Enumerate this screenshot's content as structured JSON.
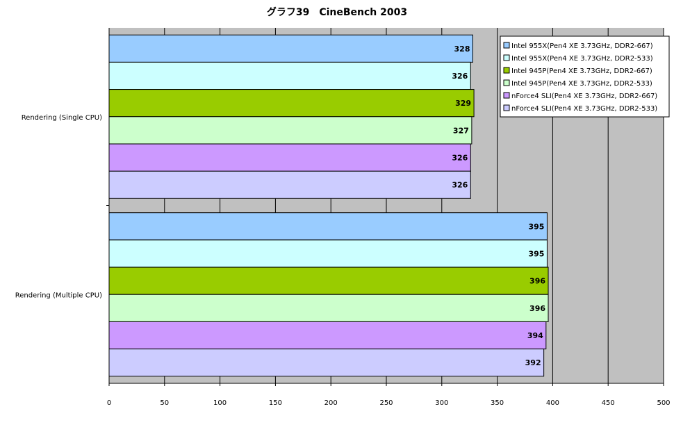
{
  "chart_data": {
    "type": "bar",
    "orientation": "horizontal",
    "title": "グラフ39　CineBench 2003",
    "xlabel": "",
    "ylabel": "",
    "xlim": [
      0,
      500
    ],
    "x_ticks": [
      0,
      50,
      100,
      150,
      200,
      250,
      300,
      350,
      400,
      450,
      500
    ],
    "grid": true,
    "legend_position": "top-right",
    "categories": [
      "Rendering (Single CPU)",
      "Rendering (Multiple CPU)"
    ],
    "series": [
      {
        "name": "Intel 955X(Pen4 XE 3.73GHz, DDR2-667)",
        "color": "#99CCFF",
        "values": [
          328,
          395
        ]
      },
      {
        "name": "Intel 955X(Pen4 XE 3.73GHz, DDR2-533)",
        "color": "#CCFFFF",
        "values": [
          326,
          395
        ]
      },
      {
        "name": "Intel 945P(Pen4 XE 3.73GHz, DDR2-667)",
        "color": "#99CC00",
        "values": [
          329,
          396
        ]
      },
      {
        "name": "Intel 945P(Pen4 XE 3.73GHz, DDR2-533)",
        "color": "#CCFFCC",
        "values": [
          327,
          396
        ]
      },
      {
        "name": "nForce4 SLI(Pen4 XE 3.73GHz, DDR2-667)",
        "color": "#CC99FF",
        "values": [
          326,
          394
        ]
      },
      {
        "name": "nForce4 SLI(Pen4 XE 3.73GHz, DDR2-533)",
        "color": "#CCCCFF",
        "values": [
          326,
          392
        ]
      }
    ],
    "plot_background": "#C0C0C0",
    "bar_border_color": "#000000"
  }
}
